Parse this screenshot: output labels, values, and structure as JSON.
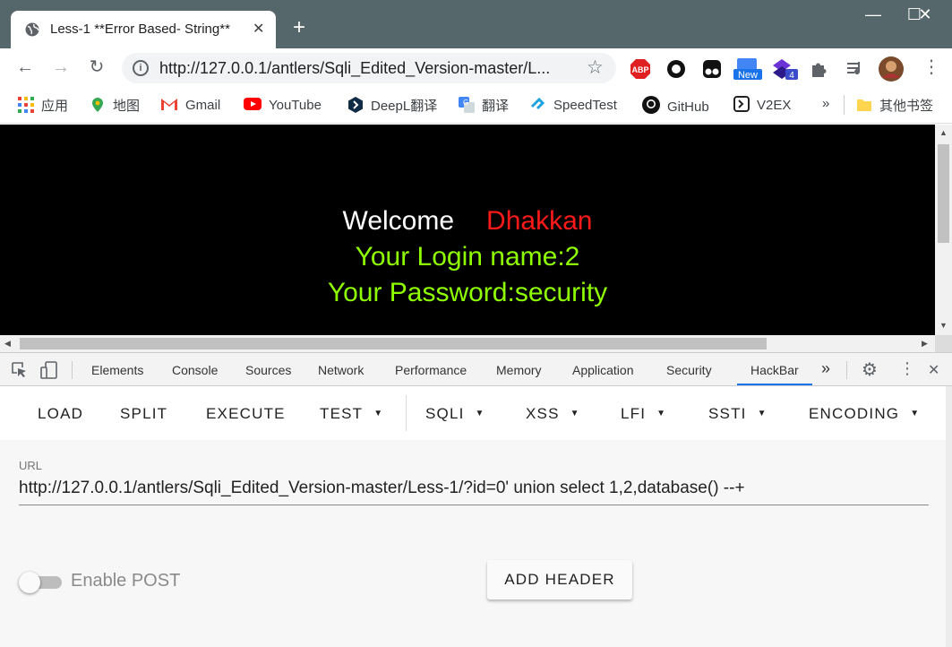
{
  "window": {
    "tab_title": "Less-1 **Error Based- String**",
    "tab_close": "✕",
    "new_tab": "+",
    "minimize": "—",
    "maximize": "☐",
    "close": "✕"
  },
  "nav": {
    "back": "←",
    "forward": "→",
    "reload": "↻",
    "url": "http://127.0.0.1/antlers/Sqli_Edited_Version-master/L...",
    "star": "☆",
    "extensions": [
      {
        "name": "adblock-plus-icon",
        "text": "ABP"
      },
      {
        "name": "circle-extension-icon",
        "text": ""
      },
      {
        "name": "tampermonkey-icon",
        "text": ""
      },
      {
        "name": "new-extension-icon",
        "text": "New"
      },
      {
        "name": "hackbar-extension-icon",
        "text": "4"
      },
      {
        "name": "puzzle-icon",
        "text": ""
      },
      {
        "name": "media-control-icon",
        "text": ""
      },
      {
        "name": "profile-avatar",
        "text": ""
      }
    ],
    "menu": "⋮"
  },
  "bookmarks": {
    "items": [
      "应用",
      "地图",
      "Gmail",
      "YouTube",
      "DeepL翻译",
      "翻译",
      "SpeedTest",
      "GitHub",
      "V2EX"
    ],
    "more": "»",
    "other": "其他书签"
  },
  "page": {
    "welcome": "Welcome",
    "name": "Dhakkan",
    "login": "Your Login name:2",
    "password": "Your Password:security"
  },
  "devtools": {
    "tabs": [
      "Elements",
      "Console",
      "Sources",
      "Network",
      "Performance",
      "Memory",
      "Application",
      "Security",
      "HackBar"
    ],
    "active_tab": "HackBar",
    "more": "»",
    "settings": "⚙",
    "menu": "⋮",
    "close": "✕"
  },
  "hackbar": {
    "buttons": {
      "load": "LOAD",
      "split": "SPLIT",
      "execute": "EXECUTE",
      "test": "TEST",
      "sqli": "SQLI",
      "xss": "XSS",
      "lfi": "LFI",
      "ssti": "SSTI",
      "encoding": "ENCODING"
    },
    "url_label": "URL",
    "url_value": "http://127.0.0.1/antlers/Sqli_Edited_Version-master/Less-1/?id=0' union select 1,2,database() --+",
    "enable_post_label": "Enable POST",
    "enable_post": false,
    "add_header": "ADD HEADER"
  },
  "colors": {
    "titlebar": "#56676b",
    "welcome_text": "#ffffff",
    "name_text": "#ff1a1a",
    "login_text": "#8fff00",
    "accent": "#1a73e8"
  }
}
